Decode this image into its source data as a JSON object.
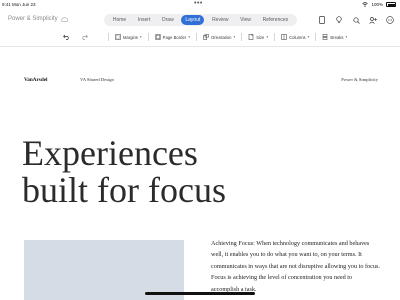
{
  "status_bar": {
    "time": "9:41",
    "date": "Mon Jun 23",
    "dots": "•••",
    "battery": "100%"
  },
  "app": {
    "doc_title": "Power & Simplicity",
    "tabs": [
      {
        "label": "Home",
        "active": false
      },
      {
        "label": "Insert",
        "active": false
      },
      {
        "label": "Draw",
        "active": false
      },
      {
        "label": "Layout",
        "active": true
      },
      {
        "label": "Review",
        "active": false
      },
      {
        "label": "View",
        "active": false
      },
      {
        "label": "References",
        "active": false
      }
    ],
    "accent_color": "#2f6fd6"
  },
  "ribbon": {
    "items": [
      {
        "label": "Margins"
      },
      {
        "label": "Page Border"
      },
      {
        "label": "Orientation"
      },
      {
        "label": "Size"
      },
      {
        "label": "Columns"
      },
      {
        "label": "Breaks"
      }
    ]
  },
  "document": {
    "logo": "VanArsdel",
    "subhead": "VA Shared Design",
    "header_right": "Power & Simplicity",
    "hero_line1": "Experiences",
    "hero_line2": "built for focus",
    "body": "Achieving Focus: When technology communicates and behaves well, it enables you to do what you want to, on your terms. It communicates in ways that are not disruptive allowing you to focus. Focus is achieving the level of concentration you need to accomplish a task."
  }
}
